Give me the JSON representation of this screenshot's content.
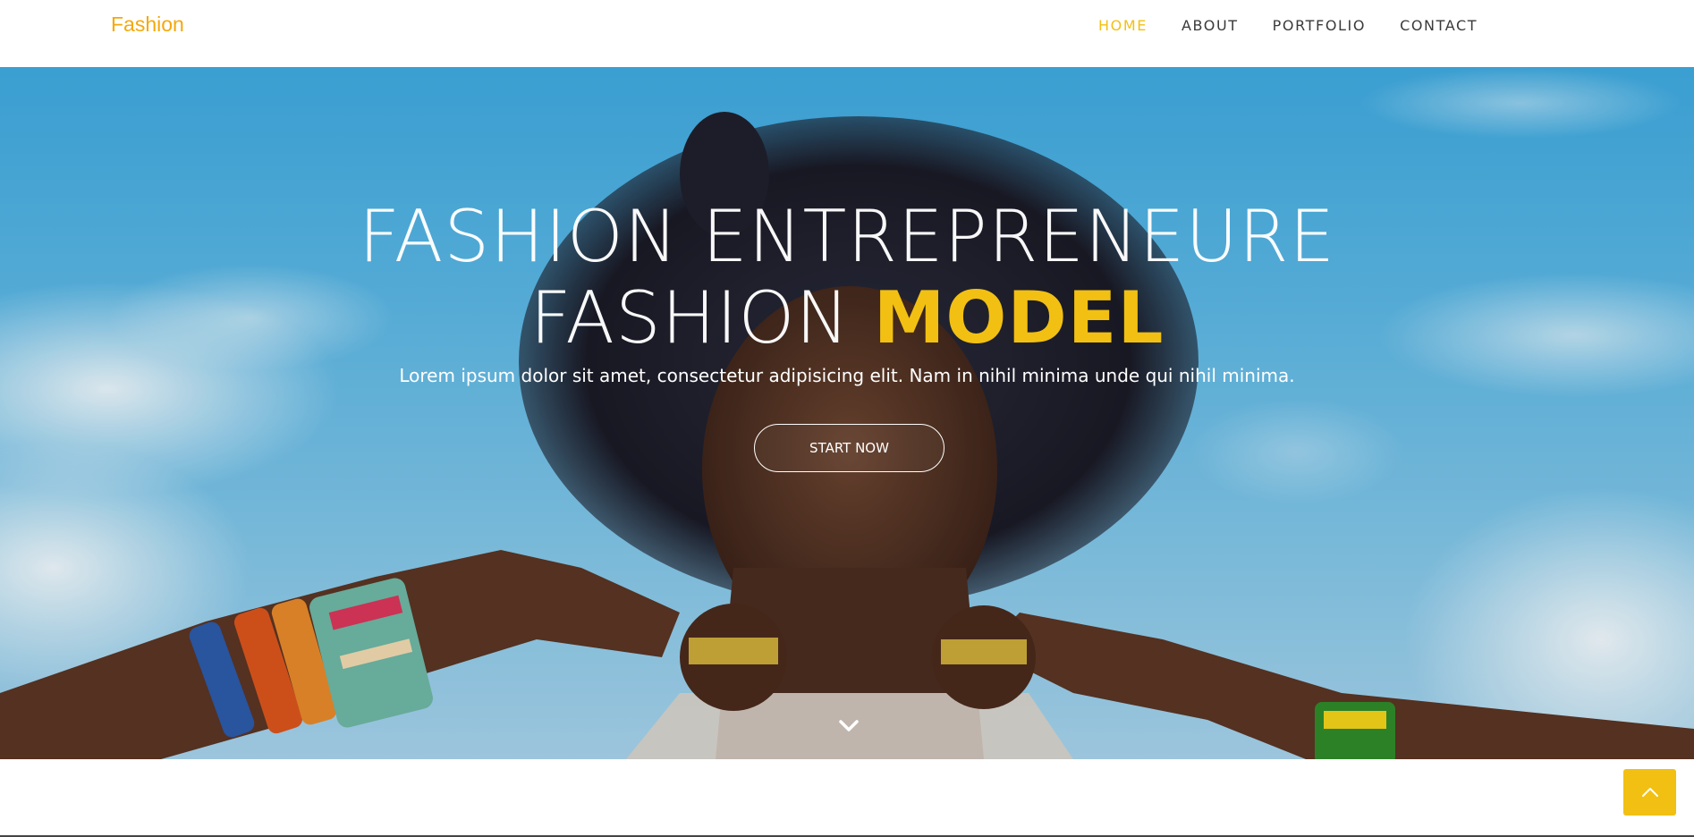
{
  "navbar": {
    "brand": "Fashion",
    "links": [
      {
        "label": "HOME",
        "active": true
      },
      {
        "label": "ABOUT",
        "active": false
      },
      {
        "label": "PORTFOLIO",
        "active": false
      },
      {
        "label": "CONTACT",
        "active": false
      }
    ]
  },
  "hero": {
    "title_line1": "FASHION ENTREPRENEURE",
    "title_line2_prefix": "FASHION",
    "title_line2_accent": "MODEL",
    "subtitle": "Lorem ipsum dolor sit amet, consectetur adipisicing elit. Nam in nihil minima unde qui nihil minima.",
    "cta_label": "START NOW",
    "scroll_icon": "chevron-down-icon"
  },
  "back_to_top": {
    "icon": "chevron-up-icon"
  },
  "colors": {
    "brand": "#f5a80a",
    "accent": "#f2c012",
    "nav_text": "#3a3a3a",
    "sky": "#3ea9df"
  }
}
